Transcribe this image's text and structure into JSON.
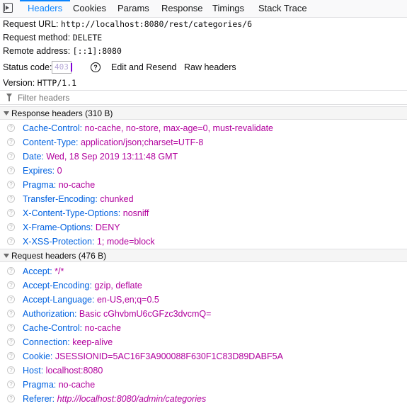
{
  "tabs": [
    "Headers",
    "Cookies",
    "Params",
    "Response",
    "Timings",
    "Stack Trace"
  ],
  "summary": {
    "request_url_label": "Request URL:",
    "request_url": "http://localhost:8080/rest/categories/6",
    "method_label": "Request method:",
    "method": "DELETE",
    "remote_label": "Remote address:",
    "remote": "[::1]:8080",
    "status_label": "Status code:",
    "status_code": "403",
    "help_symbol": "?",
    "edit_resend": "Edit and Resend",
    "raw_headers": "Raw headers",
    "version_label": "Version:",
    "version": "HTTP/1.1"
  },
  "filter": {
    "placeholder": "Filter headers"
  },
  "help_glyph": "?",
  "response_headers": {
    "title": "Response headers (310 B)",
    "rows": [
      {
        "name": "Cache-Control:",
        "value": "no-cache, no-store, max-age=0, must-revalidate"
      },
      {
        "name": "Content-Type:",
        "value": "application/json;charset=UTF-8"
      },
      {
        "name": "Date:",
        "value": "Wed, 18 Sep 2019 13:11:48 GMT"
      },
      {
        "name": "Expires:",
        "value": "0"
      },
      {
        "name": "Pragma:",
        "value": "no-cache"
      },
      {
        "name": "Transfer-Encoding:",
        "value": "chunked"
      },
      {
        "name": "X-Content-Type-Options:",
        "value": "nosniff"
      },
      {
        "name": "X-Frame-Options:",
        "value": "DENY"
      },
      {
        "name": "X-XSS-Protection:",
        "value": "1; mode=block"
      }
    ]
  },
  "request_headers": {
    "title": "Request headers (476 B)",
    "rows": [
      {
        "name": "Accept:",
        "value": "*/*"
      },
      {
        "name": "Accept-Encoding:",
        "value": "gzip, deflate"
      },
      {
        "name": "Accept-Language:",
        "value": "en-US,en;q=0.5"
      },
      {
        "name": "Authorization:",
        "value": "Basic cGhvbmU6cGFzc3dvcmQ="
      },
      {
        "name": "Cache-Control:",
        "value": "no-cache"
      },
      {
        "name": "Connection:",
        "value": "keep-alive"
      },
      {
        "name": "Cookie:",
        "value": "JSESSIONID=5AC16F3A900088F630F1C83D89DABF5A"
      },
      {
        "name": "Host:",
        "value": "localhost:8080"
      },
      {
        "name": "Pragma:",
        "value": "no-cache"
      },
      {
        "name": "Referer:",
        "value": "http://localhost:8080/admin/categories"
      }
    ]
  },
  "colors": {
    "accent": "#0a84ff",
    "header_name": "#0061e0",
    "header_value": "#b1009d"
  }
}
